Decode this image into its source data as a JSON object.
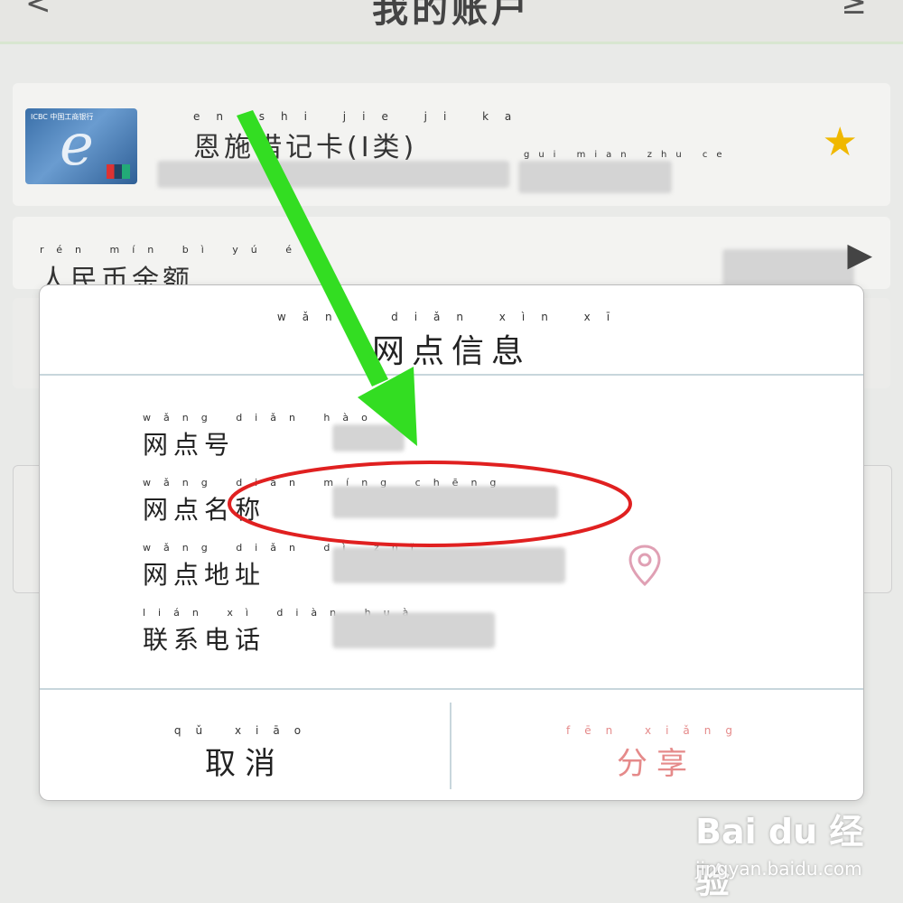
{
  "app": {
    "header": {
      "title": "我的账户",
      "back_symbol": "<",
      "right_symbol": "≥"
    },
    "account_card": {
      "bank_mark": "ICBC 中国工商银行",
      "card_name_pinyin": "en shi  jie ji ka",
      "card_name": "恩施借记卡(I类)",
      "sub_pinyin": "gui mian zhu ce",
      "favorite_icon": "star-icon"
    },
    "balance": {
      "label_pinyin": "rén mín bì yú é",
      "label": "人民币余额",
      "chevron_icon": "chevron-right-icon"
    }
  },
  "dialog": {
    "title_pinyin": "wǎng diǎn xìn xī",
    "title": "网点信息",
    "fields": [
      {
        "pinyin": "wǎng diǎn hào",
        "label": "网点号"
      },
      {
        "pinyin": "wǎng diǎn míng chēng",
        "label": "网点名称"
      },
      {
        "pinyin": "wǎng diǎn dì zhǐ",
        "label": "网点地址",
        "icon": "location-pin-icon"
      },
      {
        "pinyin": "lián xì diàn huà",
        "label": "联系电话"
      }
    ],
    "buttons": {
      "cancel_pinyin": "qǔ xiāo",
      "cancel": "取消",
      "share_pinyin": "fēn xiǎng",
      "share": "分享"
    }
  },
  "annotations": {
    "arrow_color": "#33dd22",
    "ellipse_color": "#e02020"
  },
  "watermark": {
    "logo": "Bai du 经验",
    "site": "jingyan.baidu.com"
  },
  "colors": {
    "share_text": "#e58a8a",
    "divider": "#c8d6dc",
    "star": "#f0b800"
  }
}
